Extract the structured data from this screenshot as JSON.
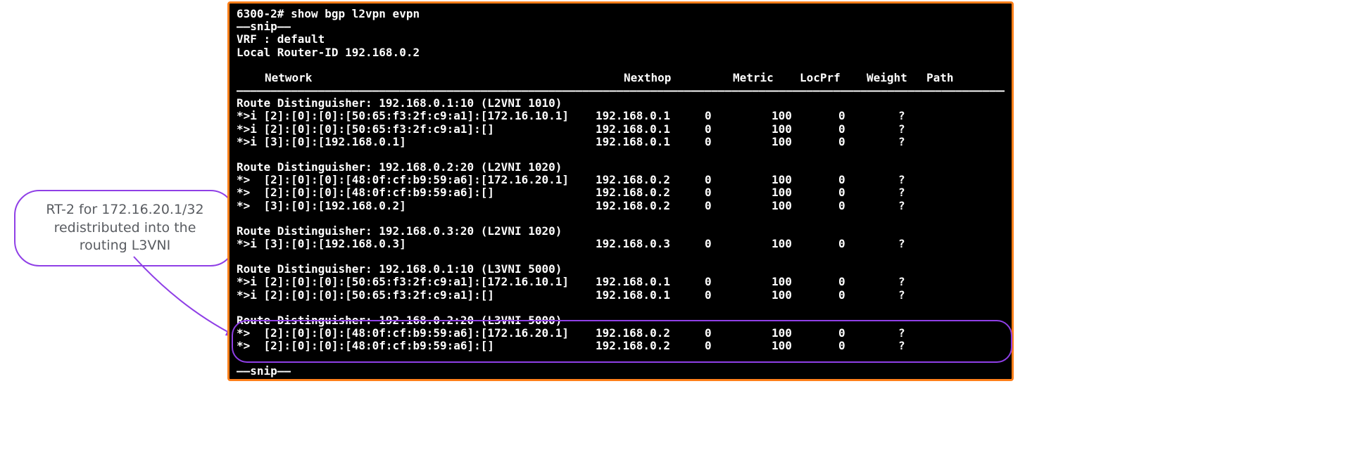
{
  "callout": {
    "text": "RT-2 for 172.16.20.1/32 redistributed into the routing L3VNI"
  },
  "terminal": {
    "prompt": "6300-2# show bgp l2vpn evpn",
    "snip": "——snip——",
    "vrf_line": "VRF : default",
    "router_id_line": "Local Router-ID 192.168.0.2",
    "cols": {
      "network": "Network",
      "nexthop": "Nexthop",
      "metric": "Metric",
      "locprf": "LocPrf",
      "weight": "Weight",
      "path": "Path"
    },
    "divider": "————————————————————————————————————————————————————————————————————————————————————————————————————————————————————————————————————",
    "groups": [
      {
        "header": "Route Distinguisher: 192.168.0.1:10      (L2VNI 1010)",
        "rows": [
          {
            "net": "*>i [2]:[0]:[0]:[50:65:f3:2f:c9:a1]:[172.16.10.1]",
            "nh": "192.168.0.1",
            "m": "0",
            "lp": "100",
            "w": "0",
            "p": "?"
          },
          {
            "net": "*>i [2]:[0]:[0]:[50:65:f3:2f:c9:a1]:[]",
            "nh": "192.168.0.1",
            "m": "0",
            "lp": "100",
            "w": "0",
            "p": "?"
          },
          {
            "net": "*>i [3]:[0]:[192.168.0.1]",
            "nh": "192.168.0.1",
            "m": "0",
            "lp": "100",
            "w": "0",
            "p": "?"
          }
        ]
      },
      {
        "header": "Route Distinguisher: 192.168.0.2:20      (L2VNI 1020)",
        "rows": [
          {
            "net": "*>  [2]:[0]:[0]:[48:0f:cf:b9:59:a6]:[172.16.20.1]",
            "nh": "192.168.0.2",
            "m": "0",
            "lp": "100",
            "w": "0",
            "p": "?"
          },
          {
            "net": "*>  [2]:[0]:[0]:[48:0f:cf:b9:59:a6]:[]",
            "nh": "192.168.0.2",
            "m": "0",
            "lp": "100",
            "w": "0",
            "p": "?"
          },
          {
            "net": "*>  [3]:[0]:[192.168.0.2]",
            "nh": "192.168.0.2",
            "m": "0",
            "lp": "100",
            "w": "0",
            "p": "?"
          }
        ]
      },
      {
        "header": "Route Distinguisher: 192.168.0.3:20      (L2VNI 1020)",
        "rows": [
          {
            "net": "*>i [3]:[0]:[192.168.0.3]",
            "nh": "192.168.0.3",
            "m": "0",
            "lp": "100",
            "w": "0",
            "p": "?"
          }
        ]
      },
      {
        "header": "Route Distinguisher: 192.168.0.1:10      (L3VNI 5000)",
        "rows": [
          {
            "net": "*>i [2]:[0]:[0]:[50:65:f3:2f:c9:a1]:[172.16.10.1]",
            "nh": "192.168.0.1",
            "m": "0",
            "lp": "100",
            "w": "0",
            "p": "?"
          },
          {
            "net": "*>i [2]:[0]:[0]:[50:65:f3:2f:c9:a1]:[]",
            "nh": "192.168.0.1",
            "m": "0",
            "lp": "100",
            "w": "0",
            "p": "?"
          }
        ]
      },
      {
        "header": "Route Distinguisher: 192.168.0.2:20      (L3VNI 5000)",
        "rows": [
          {
            "net": "*>  [2]:[0]:[0]:[48:0f:cf:b9:59:a6]:[172.16.20.1]",
            "nh": "192.168.0.2",
            "m": "0",
            "lp": "100",
            "w": "0",
            "p": "?"
          },
          {
            "net": "*>  [2]:[0]:[0]:[48:0f:cf:b9:59:a6]:[]",
            "nh": "192.168.0.2",
            "m": "0",
            "lp": "100",
            "w": "0",
            "p": "?"
          }
        ]
      }
    ]
  }
}
